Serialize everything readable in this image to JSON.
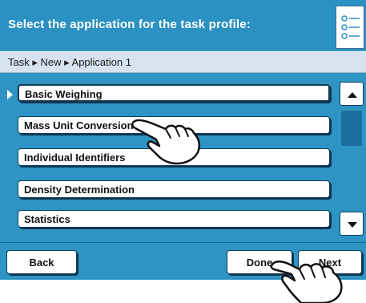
{
  "header": {
    "title": "Select the application for the task profile:",
    "menu_icon": "list-icon"
  },
  "breadcrumb": "Task ▸ New ▸ Application 1",
  "applications": [
    {
      "label": "Basic Weighing",
      "selected": true
    },
    {
      "label": "Mass Unit Conversion",
      "selected": false
    },
    {
      "label": "Individual Identifiers",
      "selected": false
    },
    {
      "label": "Density Determination",
      "selected": false
    },
    {
      "label": "Statistics",
      "selected": false
    }
  ],
  "scroll": {
    "up_icon": "triangle-up-icon",
    "down_icon": "triangle-down-icon"
  },
  "footer": {
    "back_label": "Back",
    "done_label": "Done",
    "next_label": "Next"
  },
  "colors": {
    "background": "#2e94c3",
    "button": "#ffffff",
    "border": "#0f3e5e"
  },
  "overlays": [
    "hand-pointer-icon",
    "hand-pointer-icon"
  ]
}
